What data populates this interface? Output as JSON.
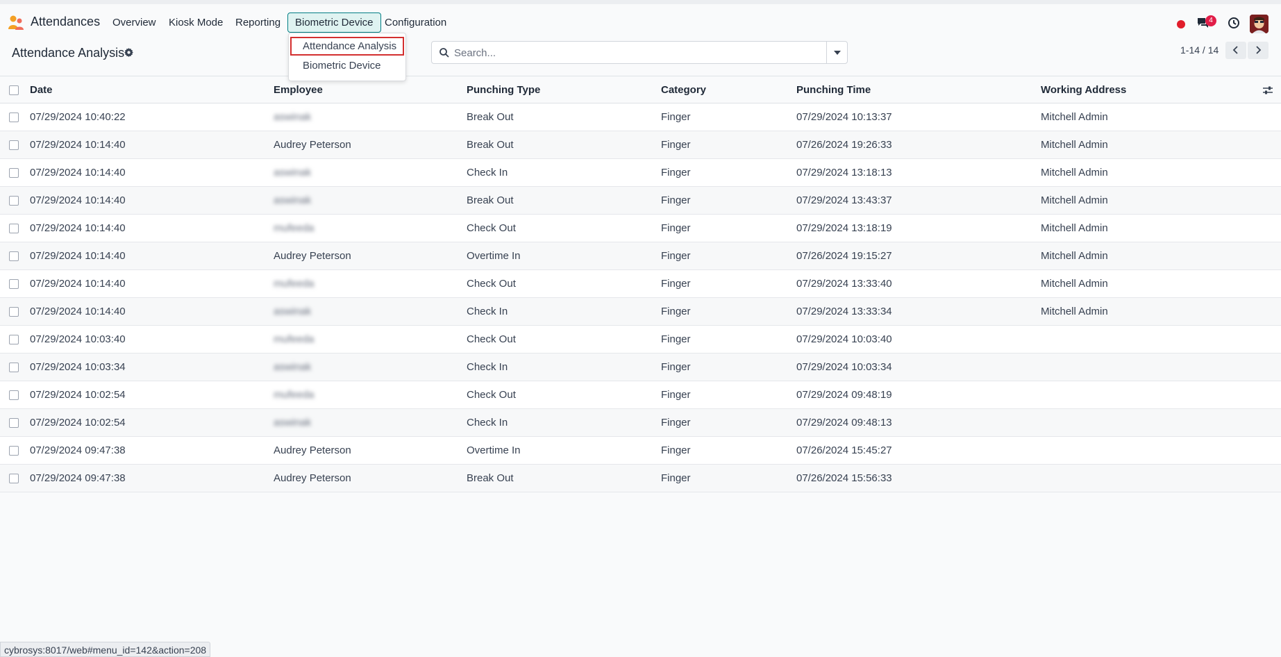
{
  "navbar": {
    "app_title": "Attendances",
    "menu": [
      "Overview",
      "Kiosk Mode",
      "Reporting",
      "Biometric Device",
      "Configuration"
    ],
    "active_menu": "Biometric Device",
    "messages_badge": "4"
  },
  "dropdown": {
    "items": [
      "Attendance Analysis",
      "Biometric Device"
    ],
    "focused": "Attendance Analysis"
  },
  "control_panel": {
    "title": "Attendance Analysis",
    "search_placeholder": "Search...",
    "pager": "1-14 / 14"
  },
  "table": {
    "columns": [
      "Date",
      "Employee",
      "Punching Type",
      "Category",
      "Punching Time",
      "Working Address"
    ],
    "rows": [
      {
        "date": "07/29/2024 10:40:22",
        "employee": "aswinak",
        "employee_blurred": true,
        "type": "Break Out",
        "category": "Finger",
        "time": "07/29/2024 10:13:37",
        "address": "Mitchell Admin"
      },
      {
        "date": "07/29/2024 10:14:40",
        "employee": "Audrey Peterson",
        "employee_blurred": false,
        "type": "Break Out",
        "category": "Finger",
        "time": "07/26/2024 19:26:33",
        "address": "Mitchell Admin"
      },
      {
        "date": "07/29/2024 10:14:40",
        "employee": "aswinak",
        "employee_blurred": true,
        "type": "Check In",
        "category": "Finger",
        "time": "07/29/2024 13:18:13",
        "address": "Mitchell Admin"
      },
      {
        "date": "07/29/2024 10:14:40",
        "employee": "aswinak",
        "employee_blurred": true,
        "type": "Break Out",
        "category": "Finger",
        "time": "07/29/2024 13:43:37",
        "address": "Mitchell Admin"
      },
      {
        "date": "07/29/2024 10:14:40",
        "employee": "mufeeda",
        "employee_blurred": true,
        "type": "Check Out",
        "category": "Finger",
        "time": "07/29/2024 13:18:19",
        "address": "Mitchell Admin"
      },
      {
        "date": "07/29/2024 10:14:40",
        "employee": "Audrey Peterson",
        "employee_blurred": false,
        "type": "Overtime In",
        "category": "Finger",
        "time": "07/26/2024 19:15:27",
        "address": "Mitchell Admin"
      },
      {
        "date": "07/29/2024 10:14:40",
        "employee": "mufeeda",
        "employee_blurred": true,
        "type": "Check Out",
        "category": "Finger",
        "time": "07/29/2024 13:33:40",
        "address": "Mitchell Admin"
      },
      {
        "date": "07/29/2024 10:14:40",
        "employee": "aswinak",
        "employee_blurred": true,
        "type": "Check In",
        "category": "Finger",
        "time": "07/29/2024 13:33:34",
        "address": "Mitchell Admin"
      },
      {
        "date": "07/29/2024 10:03:40",
        "employee": "mufeeda",
        "employee_blurred": true,
        "type": "Check Out",
        "category": "Finger",
        "time": "07/29/2024 10:03:40",
        "address": ""
      },
      {
        "date": "07/29/2024 10:03:34",
        "employee": "aswinak",
        "employee_blurred": true,
        "type": "Check In",
        "category": "Finger",
        "time": "07/29/2024 10:03:34",
        "address": ""
      },
      {
        "date": "07/29/2024 10:02:54",
        "employee": "mufeeda",
        "employee_blurred": true,
        "type": "Check Out",
        "category": "Finger",
        "time": "07/29/2024 09:48:19",
        "address": ""
      },
      {
        "date": "07/29/2024 10:02:54",
        "employee": "aswinak",
        "employee_blurred": true,
        "type": "Check In",
        "category": "Finger",
        "time": "07/29/2024 09:48:13",
        "address": ""
      },
      {
        "date": "07/29/2024 09:47:38",
        "employee": "Audrey Peterson",
        "employee_blurred": false,
        "type": "Overtime In",
        "category": "Finger",
        "time": "07/26/2024 15:45:27",
        "address": ""
      },
      {
        "date": "07/29/2024 09:47:38",
        "employee": "Audrey Peterson",
        "employee_blurred": false,
        "type": "Break Out",
        "category": "Finger",
        "time": "07/26/2024 15:56:33",
        "address": ""
      }
    ]
  },
  "status_bar": {
    "url": "cybrosys:8017/web#menu_id=142&action=208"
  },
  "colors": {
    "accent": "#017e84",
    "record_dot": "#e11d2b",
    "badge": "#e11d48",
    "focus_outline": "#d32f2f"
  },
  "icons": [
    "app-logo-icon",
    "gear-icon",
    "search-icon",
    "caret-down-icon",
    "chevron-left-icon",
    "chevron-right-icon",
    "column-settings-icon",
    "chat-icon",
    "clock-icon",
    "record-dot-icon"
  ]
}
